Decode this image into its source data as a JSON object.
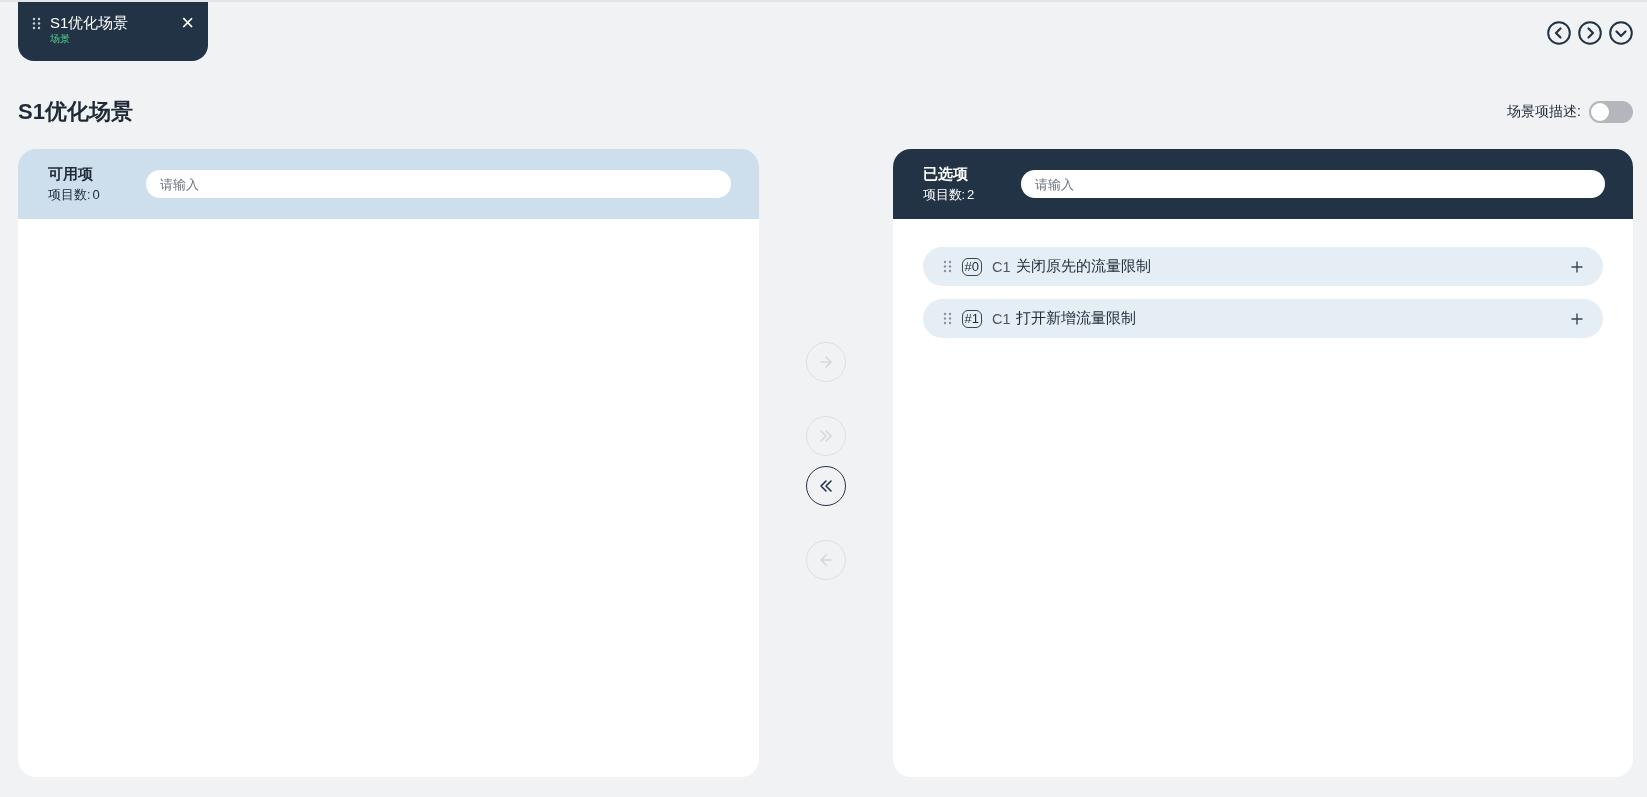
{
  "tab": {
    "title": "S1优化场景",
    "subtitle": "场景",
    "close": "×"
  },
  "nav_buttons": [
    {
      "kind": "prev"
    },
    {
      "kind": "next"
    },
    {
      "kind": "expand"
    }
  ],
  "page_title": "S1优化场景",
  "description_toggle": {
    "label": "场景项描述:",
    "on": false
  },
  "panels": [
    {
      "kind": "source",
      "title": "可用项",
      "count_label": "项目数:",
      "count": "0",
      "search": {
        "placeholder": "请输入"
      }
    },
    {
      "kind": "target",
      "title": "已选项",
      "count_label": "项目数:",
      "count": "2",
      "search": {
        "placeholder": "请输入"
      },
      "items": [
        {
          "index": "#0",
          "code": "C1",
          "label": "关闭原先的流量限制"
        },
        {
          "index": "#1",
          "code": "C1",
          "label": "打开新增流量限制"
        }
      ]
    }
  ],
  "transfer_buttons": [
    {
      "kind": "move-right",
      "disabled": true
    },
    {
      "kind": "move-all-right",
      "disabled": true
    },
    {
      "kind": "move-all-left",
      "disabled": false
    },
    {
      "kind": "move-left",
      "disabled": true
    }
  ]
}
